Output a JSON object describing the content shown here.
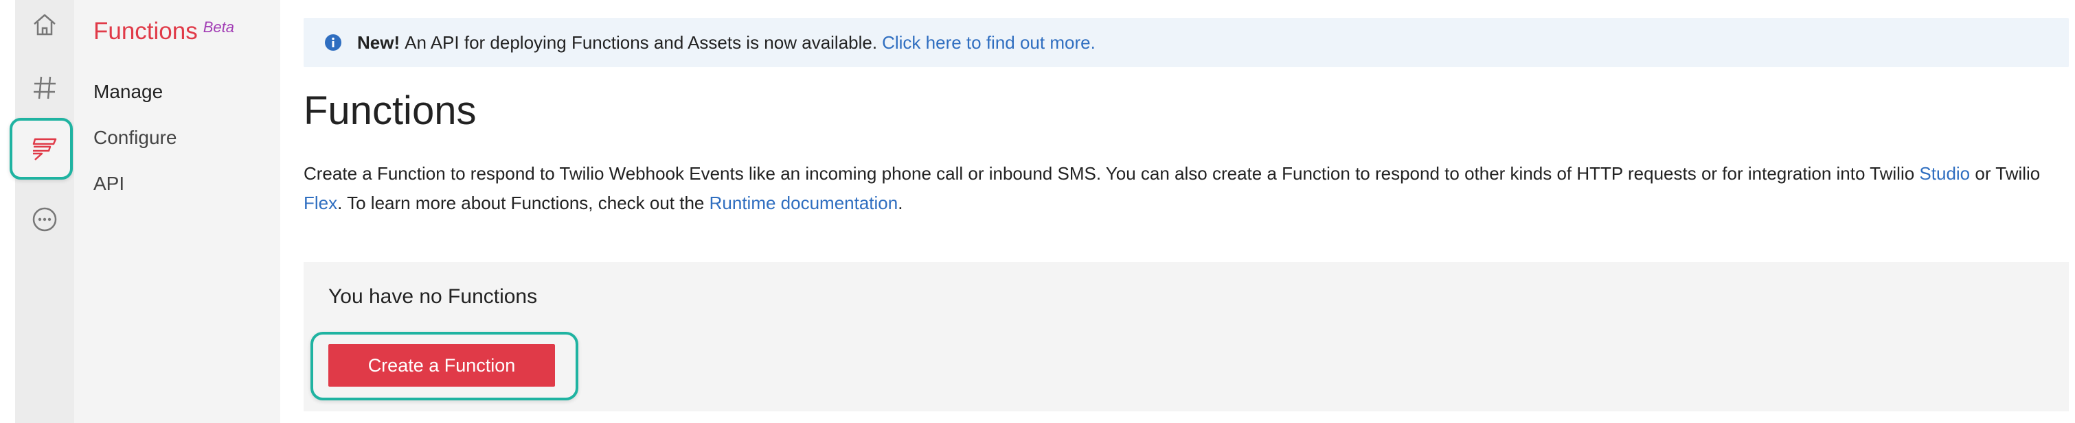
{
  "rail": {
    "icons": [
      "home-icon",
      "hashtag-icon",
      "functions-icon",
      "more-icon"
    ],
    "active_icon": "functions-icon",
    "accent_color": "#1fb3a1"
  },
  "nav": {
    "title": "Functions",
    "badge": "Beta",
    "items": [
      {
        "label": "Manage",
        "active": true
      },
      {
        "label": "Configure",
        "active": false
      },
      {
        "label": "API",
        "active": false
      }
    ]
  },
  "banner": {
    "icon": "info-icon",
    "strong": "New!",
    "text": "An API for deploying Functions and Assets is now available.",
    "link": "Click here to find out more."
  },
  "main": {
    "title": "Functions",
    "description": {
      "part1": "Create a Function to respond to Twilio Webhook Events like an incoming phone call or inbound SMS. You can also create a Function to respond to other kinds of HTTP requests or for integration into Twilio ",
      "link_studio": "Studio",
      "part2": " or Twilio ",
      "link_flex": "Flex",
      "part3": ". To learn more about Functions, check out the ",
      "link_runtime": "Runtime documentation",
      "part4": "."
    },
    "empty_state": {
      "title": "You have no Functions",
      "button": "Create a Function"
    }
  },
  "colors": {
    "brand_red": "#e03a48",
    "link_blue": "#2f6ec0",
    "beta_purple": "#a23eb5",
    "highlight_teal": "#1fb3a1"
  }
}
